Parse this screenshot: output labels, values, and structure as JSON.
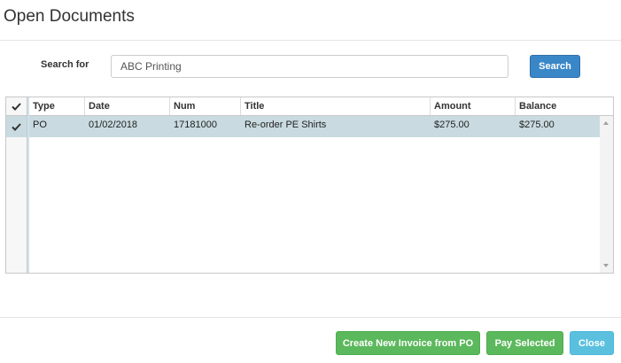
{
  "dialog": {
    "title": "Open Documents"
  },
  "search": {
    "label": "Search for",
    "value": "ABC Printing",
    "button_label": "Search"
  },
  "table": {
    "columns": [
      "Type",
      "Date",
      "Num",
      "Title",
      "Amount",
      "Balance"
    ],
    "rows": [
      {
        "type": "PO",
        "date": "01/02/2018",
        "num": "17181000",
        "title": "Re-order PE Shirts",
        "amount": "$275.00",
        "balance": "$275.00",
        "selected": true
      }
    ]
  },
  "footer": {
    "create_invoice_label": "Create New Invoice from PO",
    "pay_selected_label": "Pay Selected",
    "close_label": "Close"
  },
  "colors": {
    "primary": "#3a87c8",
    "success": "#5cb85c",
    "info": "#5bc0de",
    "selected_row": "#c9dbe0"
  }
}
